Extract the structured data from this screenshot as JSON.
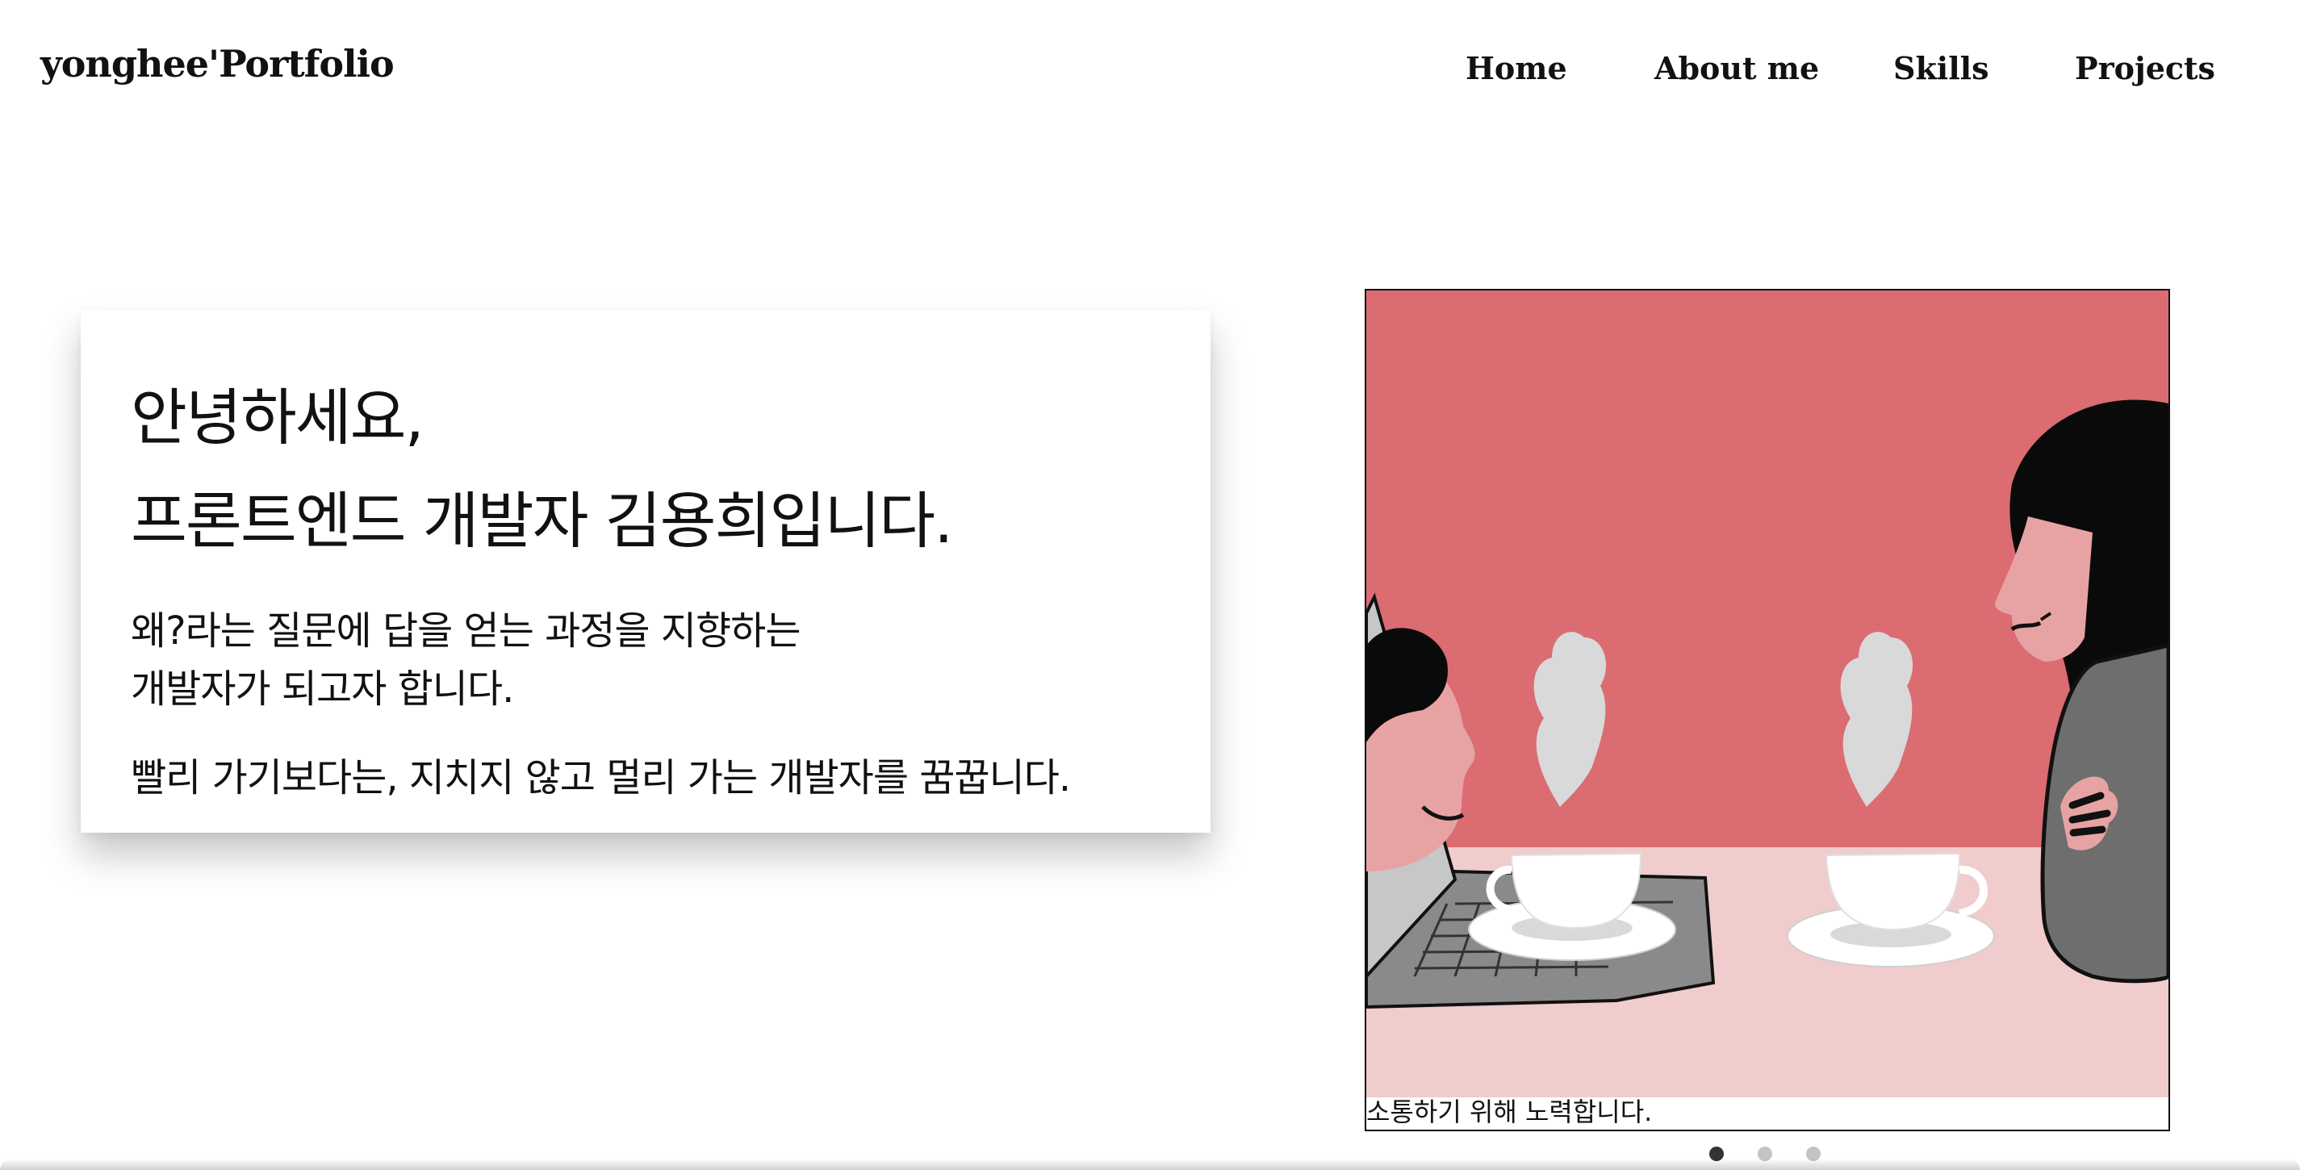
{
  "header": {
    "logo": "yonghee'Portfolio",
    "nav": [
      {
        "label": "Home"
      },
      {
        "label": "About me"
      },
      {
        "label": "Skills"
      },
      {
        "label": "Projects"
      }
    ]
  },
  "intro": {
    "greeting_line1": "안녕하세요,",
    "greeting_line2": "프론트엔드 개발자 김용희입니다.",
    "desc_line1": "왜?라는 질문에 답을 얻는 과정을 지향하는",
    "desc_line2": "개발자가 되고자 합니다.",
    "desc_line3": "빨리 가기보다는, 지치지 않고 멀리 가는 개발자를 꿈꿉니다."
  },
  "carousel": {
    "caption": "소통하기 위해 노력합니다.",
    "slide_count": 3,
    "active_index": 0
  },
  "colors": {
    "wall": "#db6c72",
    "table": "#f0cccc",
    "skin": "#e7a3a3",
    "hair": "#0a0a0a",
    "sweater": "#6e6e6e",
    "cup": "#ffffff",
    "dot_active": "#333333",
    "dot_inactive": "#c4c4c4"
  }
}
